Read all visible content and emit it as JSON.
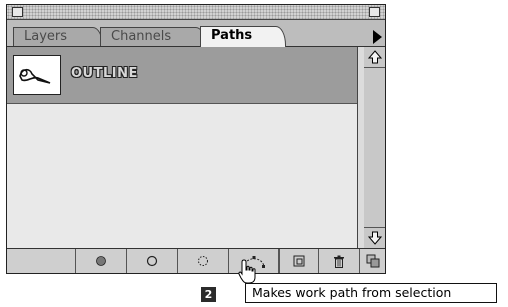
{
  "tabs": [
    {
      "label": "Layers"
    },
    {
      "label": "Channels"
    },
    {
      "label": "Paths"
    }
  ],
  "active_tab": "Paths",
  "paths": [
    {
      "name": "OUTLINE",
      "selected": true
    }
  ],
  "bottom_buttons": [
    {
      "icon": "fill-path-icon"
    },
    {
      "icon": "stroke-path-icon"
    },
    {
      "icon": "load-path-as-selection-icon"
    },
    {
      "icon": "make-work-path-icon"
    },
    {
      "icon": "new-path-icon"
    },
    {
      "icon": "trash-icon"
    }
  ],
  "tooltip": {
    "text": "Makes work path from selection"
  },
  "step_badge": "2",
  "colors": {
    "panel_bg": "#dcdcdc",
    "selected_row": "#9c9c9c",
    "list_bg": "#e9e9e9"
  }
}
